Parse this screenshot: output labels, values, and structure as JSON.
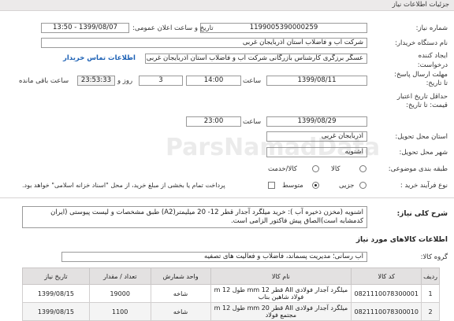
{
  "header": {
    "title": "جزئیات اطلاعات نیاز"
  },
  "fields": {
    "need_number": {
      "label": "شماره نیاز:",
      "value": "1199005390000259"
    },
    "announce_datetime": {
      "label": "تاریخ و ساعت اعلان عمومی:",
      "value": "1399/08/07 - 13:50"
    },
    "buyer_org": {
      "label": "نام دستگاه خریدار:",
      "value": "شرکت آب و فاضلاب استان آذربایجان غربی"
    },
    "requester": {
      "label": "ایجاد کننده درخواست:",
      "value": "عسگر  برزگری کارشناس بازرگانی شرکت آب و فاضلاب استان آذربایجان غربی"
    },
    "contact_link": "اطلاعات تماس خریدار",
    "deadline": {
      "label": "مهلت ارسال پاسخ: تا تاریخ:",
      "date": "1399/08/11",
      "time_label": "ساعت",
      "time": "14:00",
      "days": "3",
      "days_label": "روز و",
      "remaining": "23:53:33",
      "remaining_label": "ساعت باقی مانده"
    },
    "validity": {
      "label": "حداقل تاریخ اعتبار قیمت: تا تاریخ:",
      "date": "1399/08/29",
      "time_label": "ساعت",
      "time": "23:00"
    },
    "delivery_province": {
      "label": "استان محل تحویل:",
      "value": "آذربایجان غربی"
    },
    "delivery_city": {
      "label": "شهر محل تحویل:",
      "value": "اشنویه"
    },
    "category": {
      "label": "طبقه بندی موضوعی:",
      "options": [
        "کالا",
        "کالا/خدمت"
      ]
    },
    "process_type": {
      "label": "نوع فرآیند خرید :",
      "options": [
        "جزیی",
        "متوسط"
      ],
      "checkbox_text": "پرداخت تمام یا بخشی از مبلغ خرید، از محل \"اسناد خزانه اسلامی\" خواهد بود."
    }
  },
  "description": {
    "label": "شرح کلی نیاز:",
    "text": "اشنویه (مخزن ذخیره آب ): خرید میلگرد آجدار قطر 12- 20 میلیمتر(A2) طبق مشخصات و لیست پیوستی (ایران کدمشابه است)الصاق پیش فاکتور الزامی است."
  },
  "goods_section": {
    "title": "اطلاعات کالاهای مورد نیاز"
  },
  "goods_group": {
    "label": "گروه کالا:",
    "value": "آب رسانی؛ مدیریت پسماند، فاضلاب و فعالیت های تصفیه"
  },
  "table": {
    "headers": [
      "ردیف",
      "کد کالا",
      "نام کالا",
      "واحد شمارش",
      "تعداد / مقدار",
      "تاریخ نیاز"
    ],
    "rows": [
      {
        "row": "1",
        "code": "0821110078300001",
        "name": "میلگرد آجدار فولادی AII قطر 12 mm طول 12 m فولاد شاهین بناب",
        "unit": "شاخه",
        "qty": "19000",
        "date": "1399/08/15"
      },
      {
        "row": "2",
        "code": "0821110078300010",
        "name": "میلگرد آجدار فولادی AII قطر 20 mm طول 12 m مجتمع فولاد",
        "unit": "شاخه",
        "qty": "1100",
        "date": "1399/08/15"
      }
    ]
  },
  "watermark": "ParsNamadData"
}
